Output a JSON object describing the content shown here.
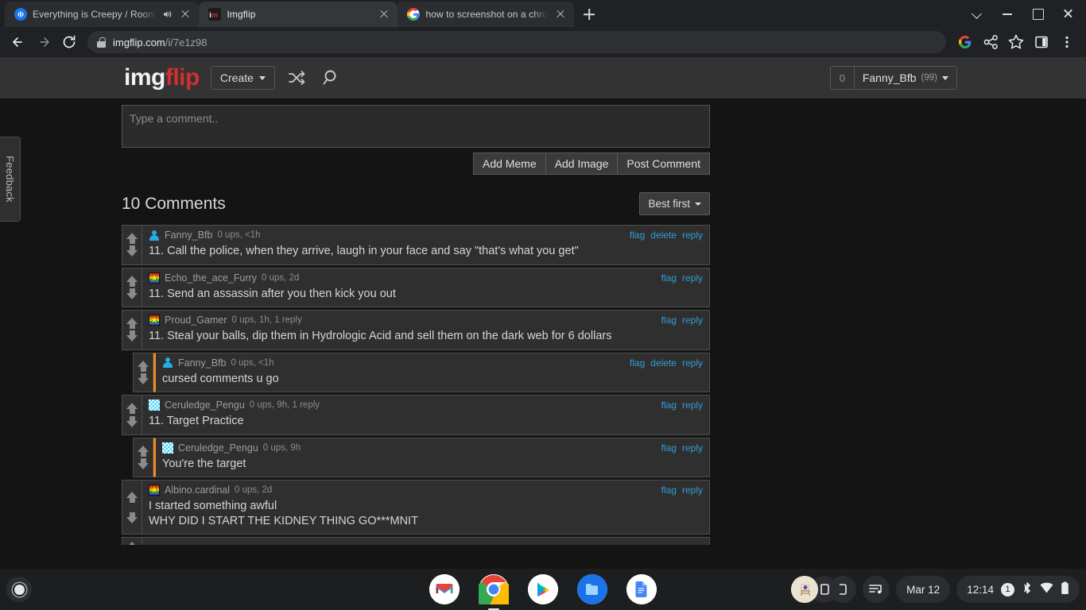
{
  "browser": {
    "tabs": [
      {
        "title": "Everything is Creepy / Room",
        "favicon": "podcast-icon",
        "audio": true,
        "active": false
      },
      {
        "title": "Imgflip",
        "favicon": "imgflip-icon",
        "audio": false,
        "active": true
      },
      {
        "title": "how to screenshot on a chromeb",
        "favicon": "google-icon",
        "audio": false,
        "active": false
      }
    ],
    "new_tab_label": "+",
    "omnibox": {
      "host": "imgflip.com",
      "path": "/i/7e1z98",
      "lock": "lock-icon"
    },
    "toolbar_icons": [
      "back-icon",
      "forward-icon",
      "reload-icon"
    ],
    "right_icons": [
      "google-lens-icon",
      "share-icon",
      "bookmark-star-icon",
      "side-panel-icon",
      "overflow-menu-icon"
    ],
    "window_controls": [
      "chevron-down-icon",
      "minimize-icon",
      "maximize-icon",
      "close-icon"
    ]
  },
  "site": {
    "logo": {
      "first": "img",
      "second": "flip"
    },
    "create_label": "Create",
    "shuffle_icon": "shuffle-icon",
    "search_icon": "search-icon",
    "user": {
      "count": "0",
      "name": "Fanny_Bfb",
      "points": "(99)"
    },
    "feedback_label": "Feedback"
  },
  "composer": {
    "placeholder": "Type a comment..",
    "value": "",
    "buttons": [
      "Add Meme",
      "Add Image",
      "Post Comment"
    ]
  },
  "comments_header": {
    "title": "10 Comments",
    "sort_label": "Best first"
  },
  "comments": [
    {
      "author": "Fanny_Bfb",
      "avatar": "person-avatar",
      "stats": "0 ups, <1h",
      "actions": [
        "flag",
        "delete",
        "reply"
      ],
      "lines": [
        "11. Call the police, when they arrive, laugh in your face and say \"that's what you get\""
      ],
      "nested": false
    },
    {
      "author": "Echo_the_ace_Furry",
      "avatar": "rainbow-star-avatar",
      "stats": "0 ups, 2d",
      "actions": [
        "flag",
        "reply"
      ],
      "lines": [
        "11. Send an assassin after you then kick you out"
      ],
      "nested": false
    },
    {
      "author": "Proud_Gamer",
      "avatar": "rainbow-star-avatar",
      "stats": "0 ups, 1h, 1 reply",
      "actions": [
        "flag",
        "reply"
      ],
      "lines": [
        "11. Steal your balls, dip them in Hydrologic Acid and sell them on the dark web for 6 dollars"
      ],
      "nested": false
    },
    {
      "author": "Fanny_Bfb",
      "avatar": "person-avatar",
      "stats": "0 ups, <1h",
      "actions": [
        "flag",
        "delete",
        "reply"
      ],
      "lines": [
        "cursed comments u go"
      ],
      "nested": true
    },
    {
      "author": "Ceruledge_Pengu",
      "avatar": "cyan-checker-avatar",
      "stats": "0 ups, 9h, 1 reply",
      "actions": [
        "flag",
        "reply"
      ],
      "lines": [
        "11. Target Practice"
      ],
      "nested": false
    },
    {
      "author": "Ceruledge_Pengu",
      "avatar": "cyan-checker-avatar",
      "stats": "0 ups, 9h",
      "actions": [
        "flag",
        "reply"
      ],
      "lines": [
        "You're the target"
      ],
      "nested": true
    },
    {
      "author": "Albino.cardinal",
      "avatar": "rainbow-star-avatar",
      "stats": "0 ups, 2d",
      "actions": [
        "flag",
        "reply"
      ],
      "lines": [
        "I started something awful",
        "WHY DID I START THE KIDNEY THING GO***MNIT"
      ],
      "nested": false
    }
  ],
  "shelf": {
    "launcher": "launcher-button",
    "apps": [
      "gmail-icon",
      "chrome-icon",
      "play-store-icon",
      "files-icon",
      "google-docs-icon"
    ],
    "active_app": "chrome-icon",
    "tray": {
      "media_icon": "media-playlist-icon",
      "date": "Mar 12",
      "time": "12:14",
      "notification_count": "1",
      "status_icons": [
        "bluetooth-icon",
        "wifi-icon",
        "battery-icon"
      ]
    }
  },
  "colors": {
    "accent_red": "#d32f2f",
    "link_blue": "#2e9fd8",
    "nested_bar": "#f08a1e",
    "page_bg": "#141414",
    "header_bg": "#333334"
  }
}
